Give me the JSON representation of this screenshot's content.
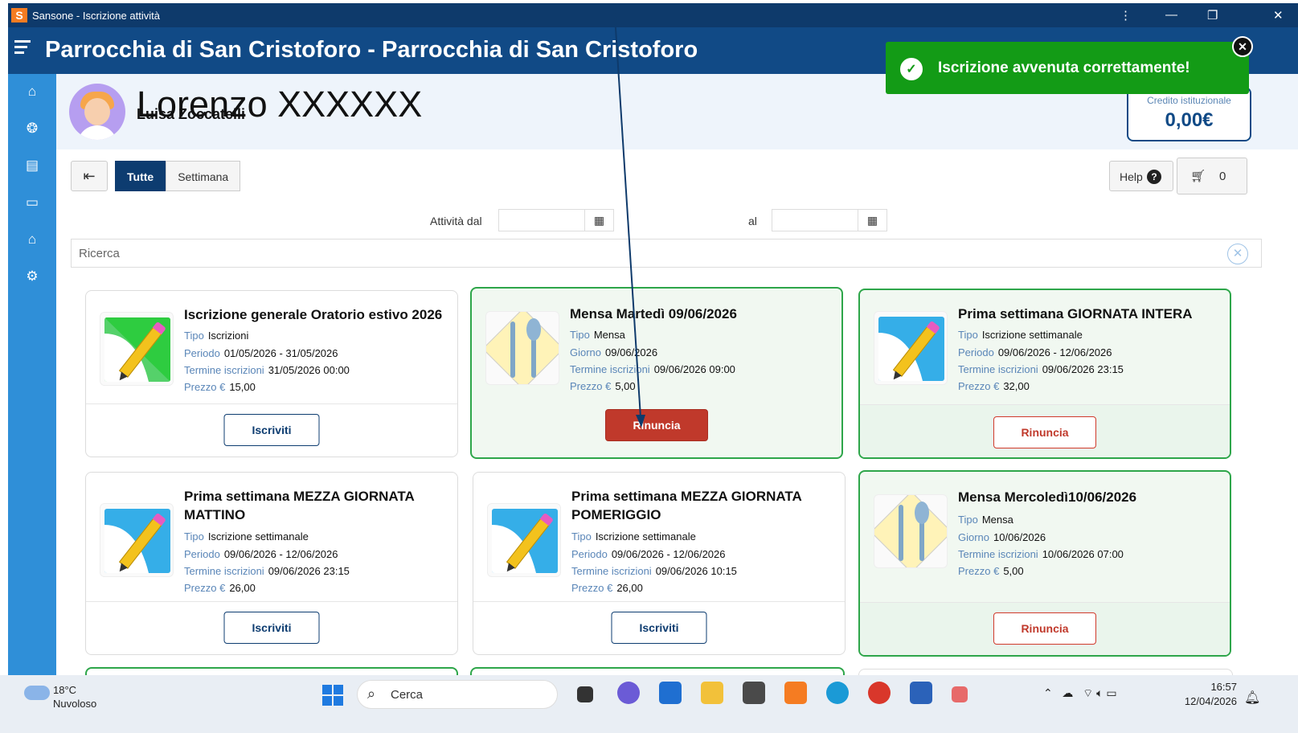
{
  "window": {
    "app_title": "Sansone - Iscrizione attività",
    "logo_letter": "S"
  },
  "header": {
    "title": "Parrocchia di San Cristoforo - Parrocchia di San Cristoforo"
  },
  "user": {
    "name_large": "Lorenzo XXXXXX",
    "name_small": "Luisa Zoccatelli"
  },
  "credit": {
    "label": "Credito istituzionale",
    "value": "0,00€"
  },
  "toast": {
    "message": "Iscrizione avvenuta correttamente!"
  },
  "toolbar": {
    "tab_all": "Tutte",
    "tab_week": "Settimana",
    "help_label": "Help",
    "cart_count": "0"
  },
  "filters": {
    "from_label": "Attività dal",
    "to_label": "al",
    "search_placeholder": "Ricerca"
  },
  "cards": [
    {
      "title": "Iscrizione generale Oratorio estivo 2026",
      "rows": [
        {
          "k": "Tipo",
          "v": "Iscrizioni"
        },
        {
          "k": "Periodo",
          "v": "01/05/2026 - 31/05/2026"
        },
        {
          "k": "Termine iscrizioni",
          "v": "31/05/2026 00:00"
        },
        {
          "k": "Prezzo €",
          "v": "15,00"
        }
      ],
      "button": "Iscriviti"
    },
    {
      "title": "Mensa Martedì 09/06/2026",
      "rows": [
        {
          "k": "Tipo",
          "v": "Mensa"
        },
        {
          "k": "Giorno",
          "v": "09/06/2026"
        },
        {
          "k": "Termine iscrizioni",
          "v": "09/06/2026 09:00"
        },
        {
          "k": "Prezzo €",
          "v": "5,00"
        }
      ],
      "button": "Rinuncia"
    },
    {
      "title": "Prima settimana GIORNATA INTERA",
      "rows": [
        {
          "k": "Tipo",
          "v": "Iscrizione settimanale"
        },
        {
          "k": "Periodo",
          "v": "09/06/2026 - 12/06/2026"
        },
        {
          "k": "Termine iscrizioni",
          "v": "09/06/2026 23:15"
        },
        {
          "k": "Prezzo €",
          "v": "32,00"
        }
      ],
      "button": "Rinuncia"
    },
    {
      "title": "Prima settimana MEZZA GIORNATA MATTINO",
      "rows": [
        {
          "k": "Tipo",
          "v": "Iscrizione settimanale"
        },
        {
          "k": "Periodo",
          "v": "09/06/2026 - 12/06/2026"
        },
        {
          "k": "Termine iscrizioni",
          "v": "09/06/2026 23:15"
        },
        {
          "k": "Prezzo €",
          "v": "26,00"
        }
      ],
      "button": "Iscriviti"
    },
    {
      "title": "Prima settimana MEZZA GIORNATA POMERIGGIO",
      "rows": [
        {
          "k": "Tipo",
          "v": "Iscrizione settimanale"
        },
        {
          "k": "Periodo",
          "v": "09/06/2026 - 12/06/2026"
        },
        {
          "k": "Termine iscrizioni",
          "v": "09/06/2026 10:15"
        },
        {
          "k": "Prezzo €",
          "v": "26,00"
        }
      ],
      "button": "Iscriviti"
    },
    {
      "title": "Mensa Mercoledì10/06/2026",
      "rows": [
        {
          "k": "Tipo",
          "v": "Mensa"
        },
        {
          "k": "Giorno",
          "v": "10/06/2026"
        },
        {
          "k": "Termine iscrizioni",
          "v": "10/06/2026 07:00"
        },
        {
          "k": "Prezzo €",
          "v": "5,00"
        }
      ],
      "button": "Rinuncia"
    }
  ],
  "taskbar": {
    "temp": "18°C",
    "weather": "Nuvoloso",
    "search": "Cerca",
    "time": "16:57",
    "date": "12/04/2026"
  },
  "colors": {
    "title_bar": "#0e3a6b",
    "header": "#114a86",
    "sidebar": "#2f8fd8",
    "success": "#139b16",
    "danger": "#c0392b",
    "selected_border": "#2ea64a"
  }
}
